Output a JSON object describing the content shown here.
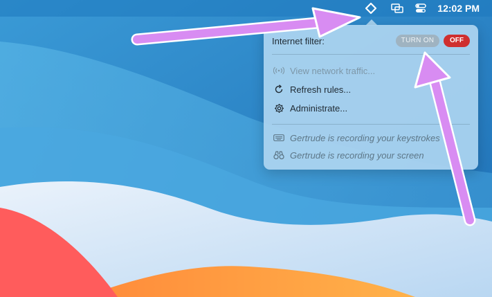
{
  "menubar": {
    "app_icon": "diamond-icon",
    "display_icon": "screen-mirroring-icon",
    "control_icon": "control-center-icon",
    "clock": "12:02 PM"
  },
  "menu": {
    "filter_label": "Internet filter:",
    "turn_on_label": "TURN ON",
    "off_label": "OFF",
    "items": [
      {
        "label": "View network traffic...",
        "icon": "antenna-icon"
      },
      {
        "label": "Refresh rules...",
        "icon": "refresh-icon"
      },
      {
        "label": "Administrate...",
        "icon": "gear-icon"
      }
    ],
    "status": [
      {
        "label": "Gertrude is recording your keystrokes",
        "icon": "keyboard-icon"
      },
      {
        "label": "Gertrude is recording your screen",
        "icon": "binoculars-icon"
      }
    ]
  },
  "colors": {
    "off_button": "#cf2f2f",
    "annotation_arrow": "#d88cf2",
    "menu_background": "#acd4f0"
  }
}
